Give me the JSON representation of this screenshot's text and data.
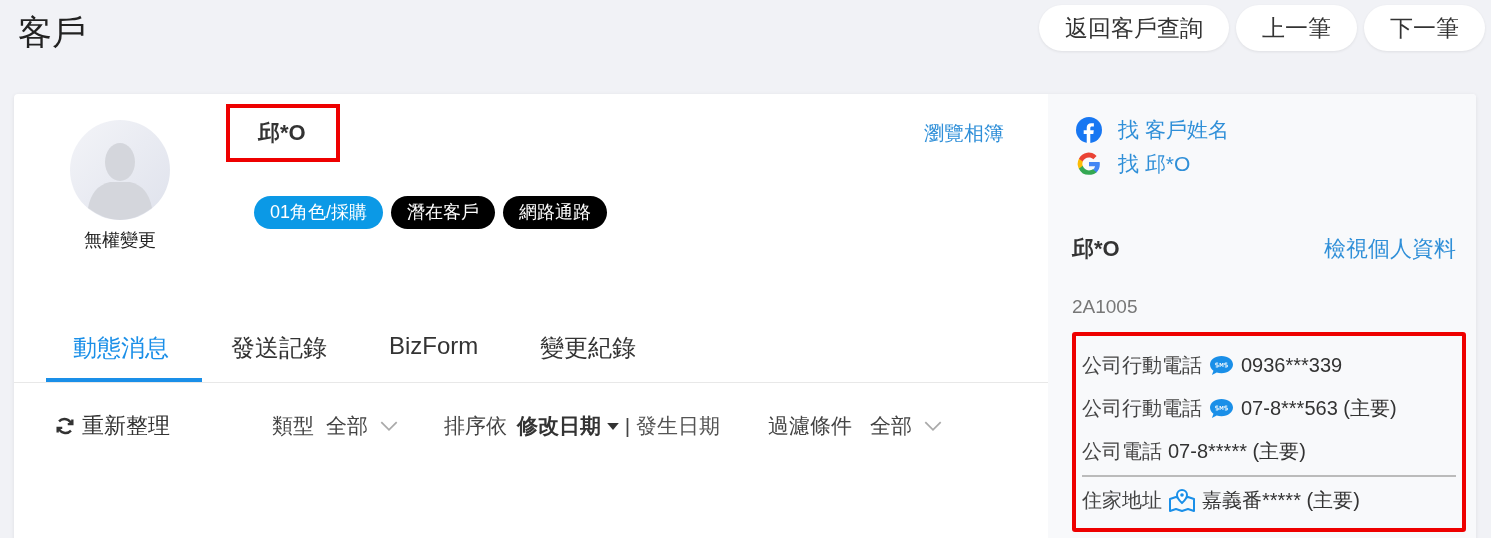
{
  "page": {
    "title": "客戶"
  },
  "nav_buttons": [
    "返回客戶查詢",
    "上一筆",
    "下一筆"
  ],
  "profile": {
    "name": "邱*O",
    "avatar_caption": "無權變更",
    "album_link": "瀏覽相簿",
    "tags": [
      {
        "label": "01角色/採購",
        "color": "#0b99e6"
      },
      {
        "label": "潛在客戶",
        "color": "#000000"
      },
      {
        "label": "網路通路",
        "color": "#000000"
      }
    ]
  },
  "tabs": [
    {
      "label": "動態消息",
      "selected": true
    },
    {
      "label": "發送記錄",
      "selected": false
    },
    {
      "label": "BizForm",
      "selected": false
    },
    {
      "label": "變更紀錄",
      "selected": false
    }
  ],
  "toolbar": {
    "refresh": "重新整理",
    "type_filter": {
      "label": "類型",
      "value": "全部"
    },
    "sort": {
      "label": "排序依",
      "separator": "|",
      "options": [
        {
          "label": "修改日期",
          "selected": true
        },
        {
          "label": "發生日期",
          "selected": false
        }
      ]
    },
    "condition_filter": {
      "label": "過濾條件",
      "value": "全部"
    }
  },
  "sidebar": {
    "searches": [
      {
        "kind": "facebook",
        "label": "找 客戶姓名"
      },
      {
        "kind": "google",
        "label": "找 邱*O"
      }
    ],
    "name": "邱*O",
    "profile_link": "檢視個人資料",
    "code": "2A1005",
    "contacts": [
      {
        "label": "公司行動電話",
        "sms": true,
        "value": "0936***339"
      },
      {
        "label": "公司行動電話",
        "sms": true,
        "value": "07-8***563 (主要)"
      },
      {
        "label": "公司電話",
        "sms": false,
        "value": "07-8***** (主要)"
      }
    ],
    "address": {
      "label": "住家地址",
      "value": "嘉義番***** (主要)"
    }
  }
}
